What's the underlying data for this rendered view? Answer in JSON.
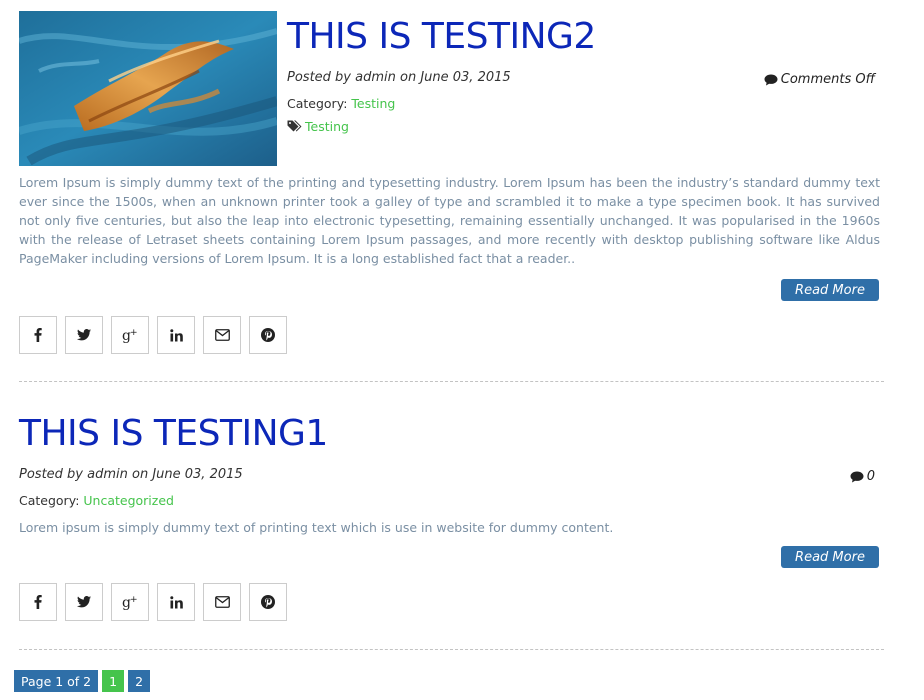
{
  "posts": [
    {
      "title": "THIS IS TESTING2",
      "meta": "Posted by admin on June 03, 2015",
      "comments": "Comments Off",
      "category_label": "Category:",
      "category_value": "Testing",
      "tag": "Testing",
      "excerpt": "Lorem Ipsum is simply dummy text of the printing and typesetting industry. Lorem Ipsum has been the industry’s standard dummy text ever since the 1500s, when an unknown printer took a galley of type and scrambled it to make a type specimen book. It has survived not only five centuries, but also the leap into electronic typesetting, remaining essentially unchanged. It was popularised in the 1960s with the release of Letraset sheets containing Lorem Ipsum passages, and more recently with desktop publishing software like Aldus PageMaker including versions of Lorem Ipsum. It is a long established fact that a reader..",
      "read_more": "Read More",
      "share_icons": [
        "facebook-icon",
        "twitter-icon",
        "google-plus-icon",
        "linkedin-icon",
        "email-icon",
        "pinterest-icon"
      ]
    },
    {
      "title": "THIS IS TESTING1",
      "meta": "Posted by admin on June 03, 2015",
      "comments": "0",
      "category_label": "Category:",
      "category_value": "Uncategorized",
      "excerpt": "Lorem ipsum is simply dummy text of printing text which is use in website for dummy content.",
      "read_more": "Read More",
      "share_icons": [
        "facebook-icon",
        "twitter-icon",
        "google-plus-icon",
        "linkedin-icon",
        "email-icon",
        "pinterest-icon"
      ]
    }
  ],
  "pagination": {
    "label": "Page 1 of 2",
    "pages": [
      "1",
      "2"
    ],
    "current": "1"
  },
  "colors": {
    "title": "#0c27b8",
    "link_green": "#45c44c",
    "button_blue": "#2f6fa8",
    "excerpt": "#7a8fa3"
  }
}
